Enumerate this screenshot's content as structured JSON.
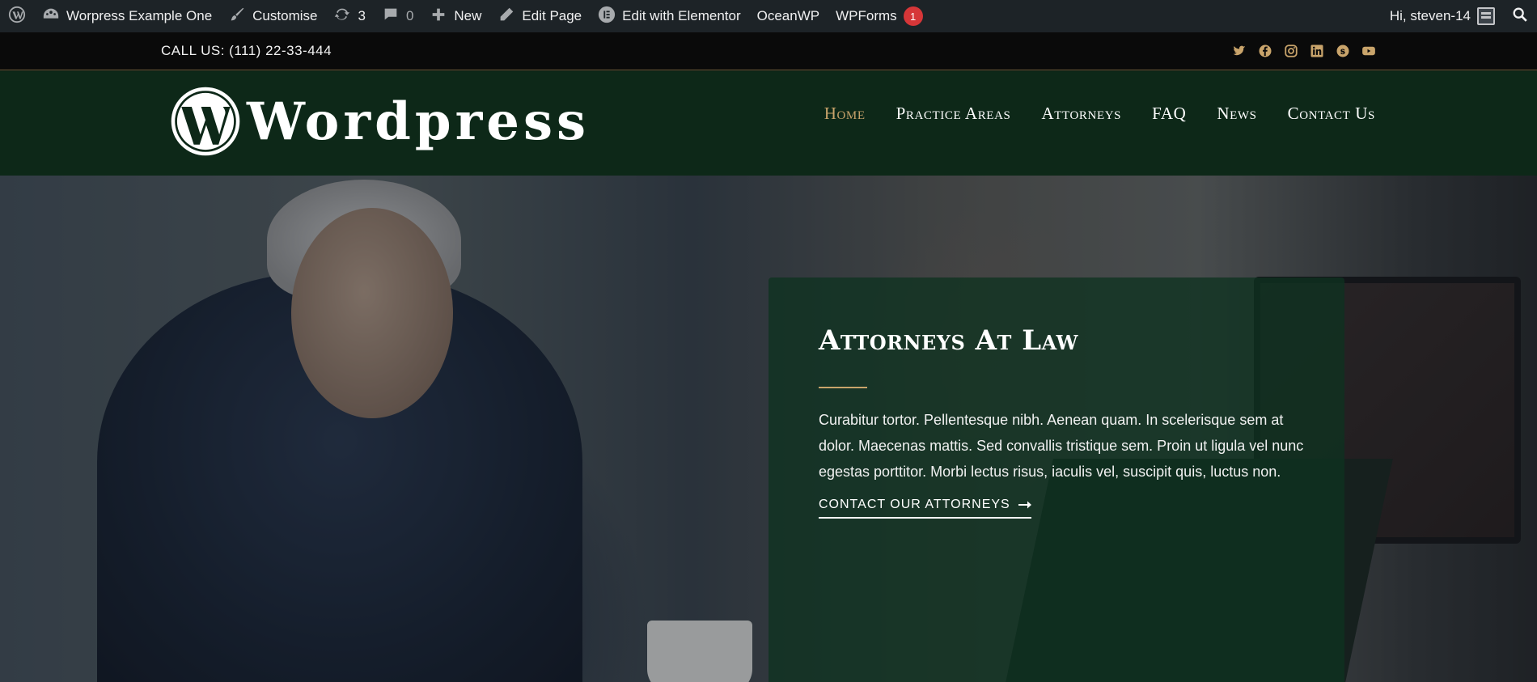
{
  "adminbar": {
    "site_name": "Worpress Example One",
    "customise": "Customise",
    "updates_count": "3",
    "comments_count": "0",
    "new": "New",
    "edit_page": "Edit Page",
    "edit_elementor": "Edit with Elementor",
    "oceanwp": "OceanWP",
    "wpforms": "WPForms",
    "wpforms_badge": "1",
    "greeting": "Hi, steven-14"
  },
  "topbar": {
    "call": "CALL US: (111) 22-33-444",
    "social_icons": [
      "twitter-icon",
      "facebook-icon",
      "instagram-icon",
      "linkedin-icon",
      "skype-icon",
      "youtube-icon"
    ]
  },
  "header": {
    "logo_text": "Wordpress",
    "nav": [
      {
        "label": "Home"
      },
      {
        "label": "Practice Areas"
      },
      {
        "label": "Attorneys"
      },
      {
        "label": "FAQ"
      },
      {
        "label": "News"
      },
      {
        "label": "Contact Us"
      }
    ]
  },
  "hero": {
    "title": "Attorneys At Law",
    "body": "Curabitur tortor. Pellentesque nibh. Aenean quam. In scelerisque sem at dolor. Maecenas mattis. Sed convallis tristique sem. Proin ut ligula vel nunc egestas porttitor. Morbi lectus risus, iaculis vel, suscipit quis, luctus non.",
    "cta": "CONTACT OUR ATTORNEYS"
  },
  "colors": {
    "accent_gold": "#c9a46b",
    "header_green": "#0d2818",
    "adminbar": "#1d2327",
    "badge_red": "#d63638"
  }
}
